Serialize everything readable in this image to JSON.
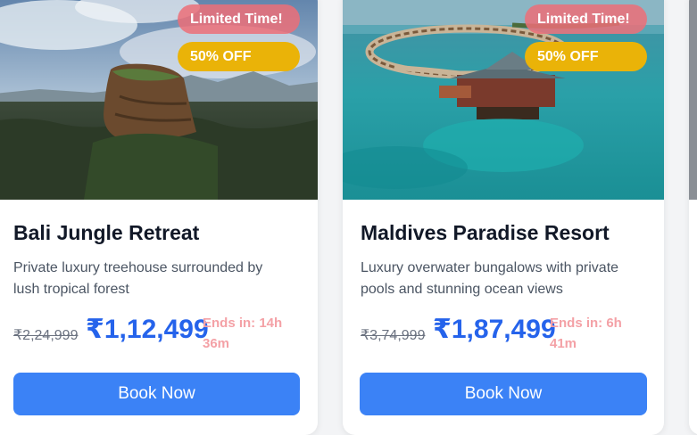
{
  "cards": [
    {
      "title": "Bali Jungle Retreat",
      "description": "Private luxury treehouse surrounded by lush tropical forest",
      "badge_limited": "Limited Time!",
      "badge_discount": "50% OFF",
      "original_price": "₹2,24,999",
      "sale_price": "₹1,12,499",
      "ends_in": "Ends in: 14h 36m",
      "button": "Book Now",
      "image": "jungle-rock-photo"
    },
    {
      "title": "Maldives Paradise Resort",
      "description": "Luxury overwater bungalows with private pools and stunning ocean views",
      "badge_limited": "Limited Time!",
      "badge_discount": "50% OFF",
      "original_price": "₹3,74,999",
      "sale_price": "₹1,87,499",
      "ends_in": "Ends in: 6h 41m",
      "button": "Book Now",
      "image": "overwater-resort-photo"
    }
  ],
  "colors": {
    "accent": "#3b82f6",
    "price": "#2563eb",
    "discount_badge": "#eab308",
    "limited_badge": "#ec6e78",
    "timer": "#f4a1a6"
  }
}
